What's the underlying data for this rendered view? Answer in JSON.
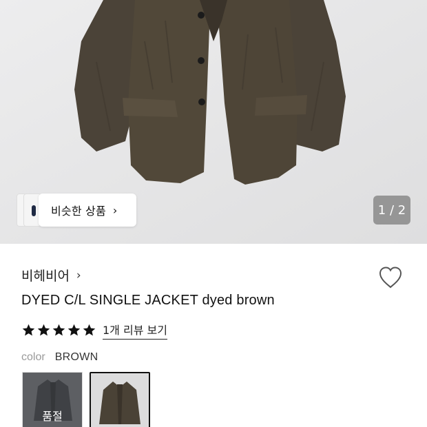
{
  "hero": {
    "similar_button_label": "비슷한 상품",
    "similar_button_chevron": "›",
    "image_counter": "1 / 2",
    "icons": [
      "chevron-right-icon"
    ]
  },
  "product": {
    "brand": "비헤비어",
    "brand_chevron": "›",
    "title": "DYED C/L SINGLE JACKET dyed brown",
    "rating_stars": 5,
    "review_link": "1개 리뷰 보기",
    "color_label": "color",
    "color_value": "BROWN",
    "swatches": [
      {
        "badge": "품절",
        "selected": false
      },
      {
        "badge": "",
        "selected": true
      }
    ]
  },
  "colors": {
    "jacket": "#4a4236",
    "background": "#e9e9eb",
    "star": "#111111"
  }
}
